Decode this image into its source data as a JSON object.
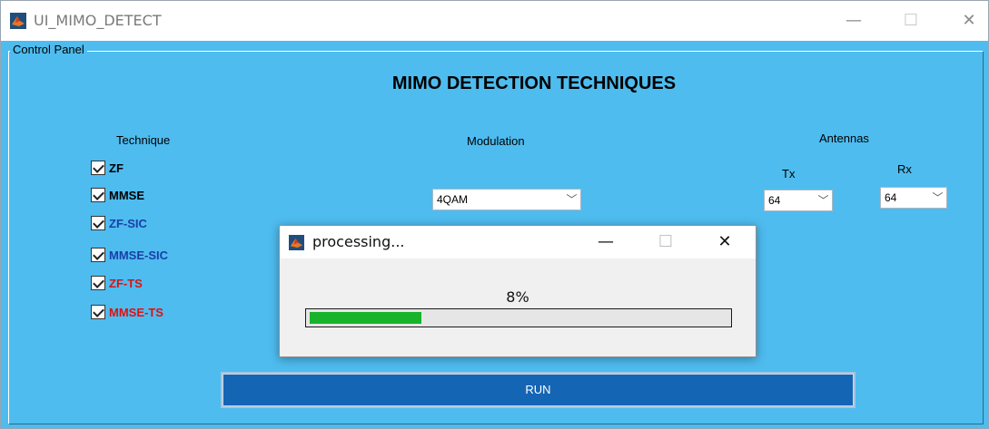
{
  "window": {
    "title": "UI_MIMO_DETECT",
    "minimize_glyph": "—",
    "maximize_glyph": "☐",
    "close_glyph": "✕"
  },
  "panel": {
    "label": "Control Panel",
    "heading": "MIMO DETECTION TECHNIQUES"
  },
  "technique": {
    "label": "Technique",
    "items": [
      {
        "label": "ZF",
        "color": "#000000",
        "checked": true
      },
      {
        "label": "MMSE",
        "color": "#000000",
        "checked": true
      },
      {
        "label": "ZF-SIC",
        "color": "#1a3fa8",
        "checked": true
      },
      {
        "label": "MMSE-SIC",
        "color": "#1a3fa8",
        "checked": true
      },
      {
        "label": "ZF-TS",
        "color": "#e01010",
        "checked": true
      },
      {
        "label": "MMSE-TS",
        "color": "#e01010",
        "checked": true
      }
    ]
  },
  "modulation": {
    "label": "Modulation",
    "selected": "4QAM"
  },
  "antennas": {
    "label": "Antennas",
    "tx_label": "Tx",
    "tx_value": "64",
    "rx_label": "Rx",
    "rx_value": "64"
  },
  "run_button": {
    "label": "RUN"
  },
  "dialog": {
    "title": "processing...",
    "minimize_glyph": "—",
    "maximize_glyph": "☐",
    "close_glyph": "✕",
    "percent_text": "8%",
    "progress": 0.08
  },
  "colors": {
    "panel_bg": "#4ebcef",
    "run_button_bg": "#1565b5",
    "progress_fill": "#18b32b"
  },
  "icons": {
    "app": "matlab-icon",
    "dropdown": "chevron-down-icon",
    "check": "check-icon"
  }
}
